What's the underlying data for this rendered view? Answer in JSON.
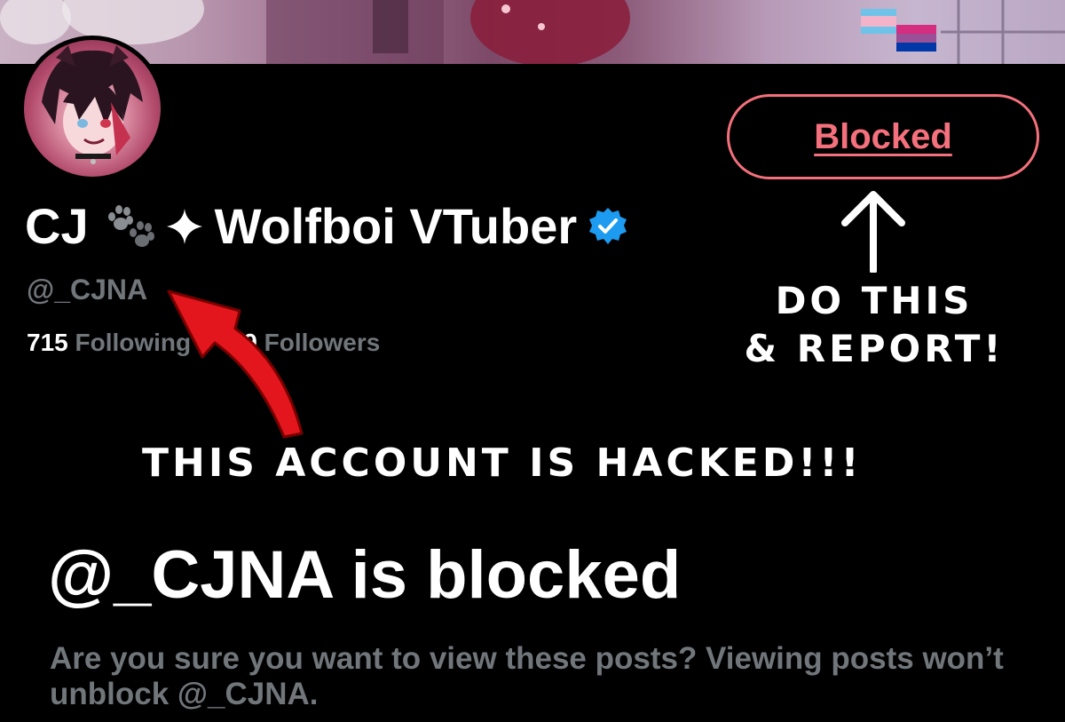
{
  "profile": {
    "display_name_start": "CJ",
    "display_name_end": "Wolfboi VTuber",
    "handle": "@_CJNA",
    "following_count": "715",
    "following_label": "Following",
    "followers_count": "99",
    "followers_label": "Followers",
    "verified": true,
    "accent_color": "#1d9bf0"
  },
  "actions": {
    "blocked_label": "Blocked",
    "blocked_color": "#f4707c"
  },
  "annotations": {
    "do_this_line1": "DO THIS",
    "do_this_line2": "& REPORT!",
    "hacked_warning": "THIS ACCOUNT IS HACKED!!!"
  },
  "blocked_notice": {
    "title": "@_CJNA is blocked",
    "description": "Are you sure you want to view these posts? Viewing posts won’t unblock @_CJNA."
  },
  "icons": {
    "name_emoji_1": "paw-prints-icon",
    "name_emoji_2": "sparkle-icon",
    "badge": "verified-badge-icon"
  }
}
